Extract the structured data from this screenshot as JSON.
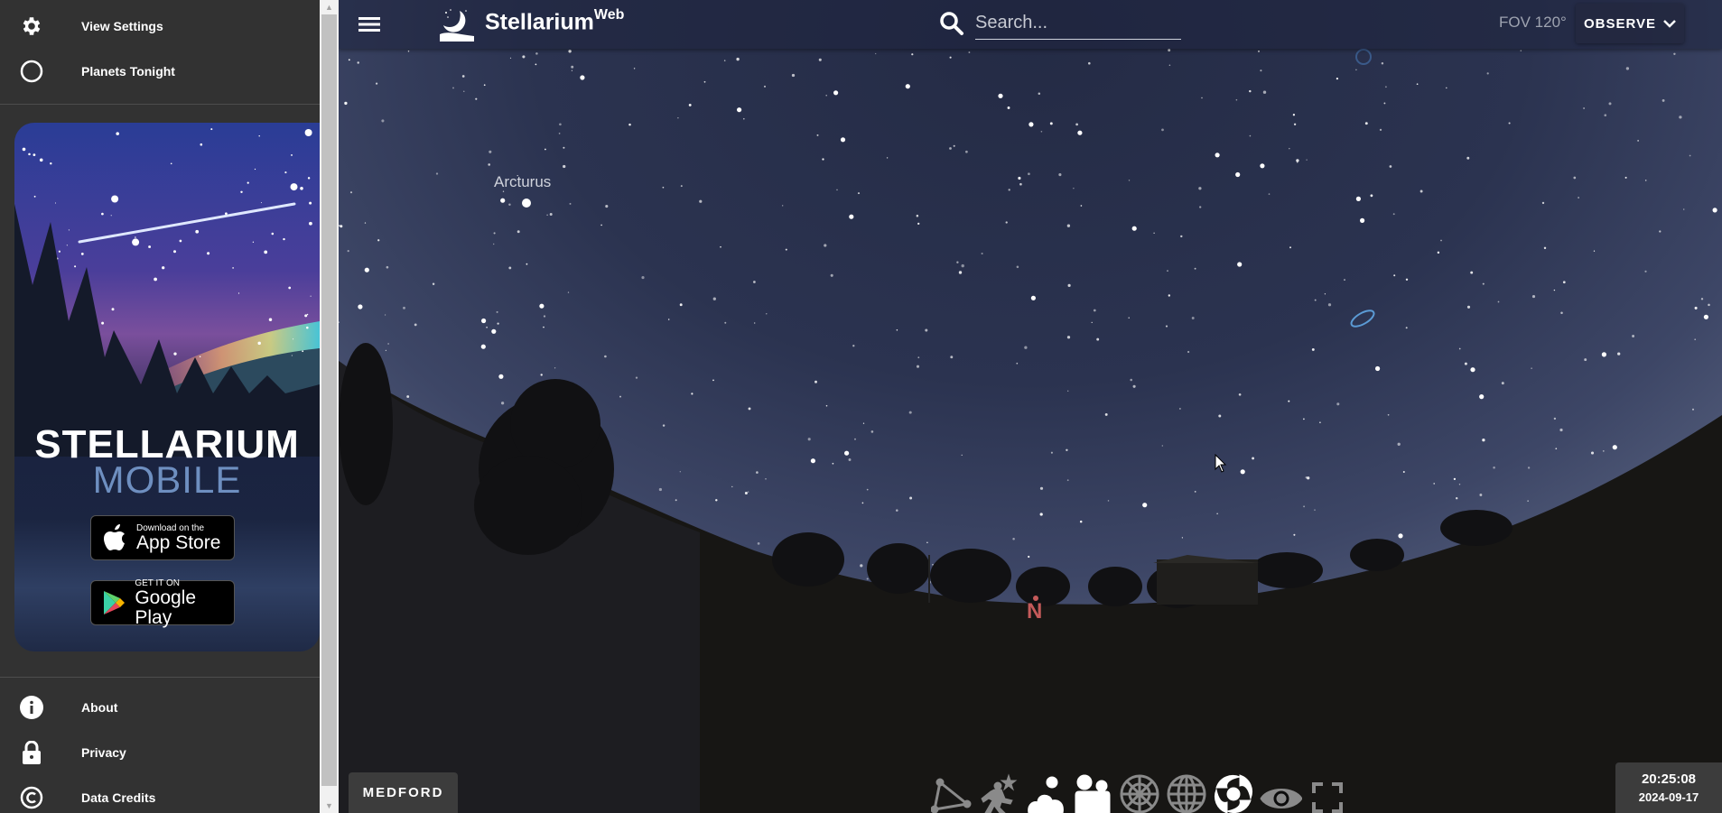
{
  "sidebar": {
    "top_items": [
      {
        "label": "View Settings",
        "icon": "gear-icon"
      },
      {
        "label": "Planets Tonight",
        "icon": "circle-icon"
      }
    ],
    "promo": {
      "title_line1": "STELLARIUM",
      "title_line2": "MOBILE",
      "app_store": {
        "small": "Download on the",
        "big": "App Store"
      },
      "google_play": {
        "small": "GET IT ON",
        "big": "Google Play"
      }
    },
    "bottom_items": [
      {
        "label": "About",
        "icon": "info-icon"
      },
      {
        "label": "Privacy",
        "icon": "lock-icon"
      },
      {
        "label": "Data Credits",
        "icon": "copyright-icon"
      }
    ]
  },
  "header": {
    "app_name": "Stellarium",
    "app_suffix": "Web",
    "search_placeholder": "Search...",
    "search_value": "",
    "fov": "FOV 120°",
    "observe_label": "OBSERVE"
  },
  "sky": {
    "star_labels": [
      {
        "name": "Arcturus"
      }
    ],
    "cardinal": "N"
  },
  "footer": {
    "location": "MEDFORD",
    "time": "20:25:08",
    "date": "2024-09-17",
    "toolbar": [
      {
        "name": "constellation-lines",
        "active": false
      },
      {
        "name": "constellation-art",
        "active": false
      },
      {
        "name": "atmosphere",
        "active": true
      },
      {
        "name": "landscape",
        "active": true
      },
      {
        "name": "azimuthal-grid",
        "active": false
      },
      {
        "name": "equatorial-grid",
        "active": false
      },
      {
        "name": "deep-sky-objects",
        "active": true
      },
      {
        "name": "night-mode",
        "active": false
      },
      {
        "name": "fullscreen",
        "active": false
      }
    ]
  },
  "colors": {
    "active_tool": "#ffffff",
    "inactive_tool": "#8a8a8a",
    "cardinal": "#c45a5a",
    "dso_marker": "#5b9bd5"
  }
}
